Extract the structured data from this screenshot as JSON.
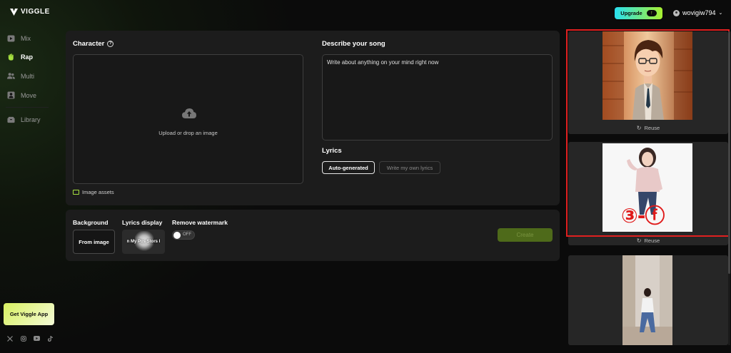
{
  "app": {
    "brand": "VIGGLE"
  },
  "header": {
    "upgrade_label": "Upgrade",
    "upgrade_arrow": "↑",
    "username": "wovigiw794",
    "chevron": "⌄"
  },
  "sidebar": {
    "items": [
      {
        "label": "Mix",
        "icon": "play-square-icon",
        "active": false
      },
      {
        "label": "Rap",
        "icon": "hand-icon",
        "active": true
      },
      {
        "label": "Multi",
        "icon": "users-icon",
        "active": false
      },
      {
        "label": "Move",
        "icon": "person-square-icon",
        "active": false
      },
      {
        "label": "Library",
        "icon": "box-icon",
        "active": false
      }
    ],
    "app_button": "Get Viggle App",
    "socials": [
      "x-icon",
      "instagram-icon",
      "youtube-icon",
      "tiktok-icon"
    ]
  },
  "character": {
    "title": "Character",
    "help_glyph": "?",
    "upload_text": "Upload or drop an image",
    "assets_link": "Image assets"
  },
  "song": {
    "title": "Describe your song",
    "value": "Write about anything on your mind right now"
  },
  "lyrics": {
    "title": "Lyrics",
    "auto_label": "Auto-generated",
    "own_label": "Write my own lyrics"
  },
  "options": {
    "background_label": "Background",
    "background_value": "From image",
    "lyrics_display_label": "Lyrics display",
    "lyrics_display_value": "n My Pos   Stors I",
    "watermark_label": "Remove watermark",
    "watermark_state": "OFF",
    "create_label": "Create"
  },
  "gallery": {
    "reuse_label": "Reuse",
    "overlay_text": "③-ⓕ",
    "colors": {
      "highlight": "#e02020",
      "accent": "#a6e040"
    }
  }
}
